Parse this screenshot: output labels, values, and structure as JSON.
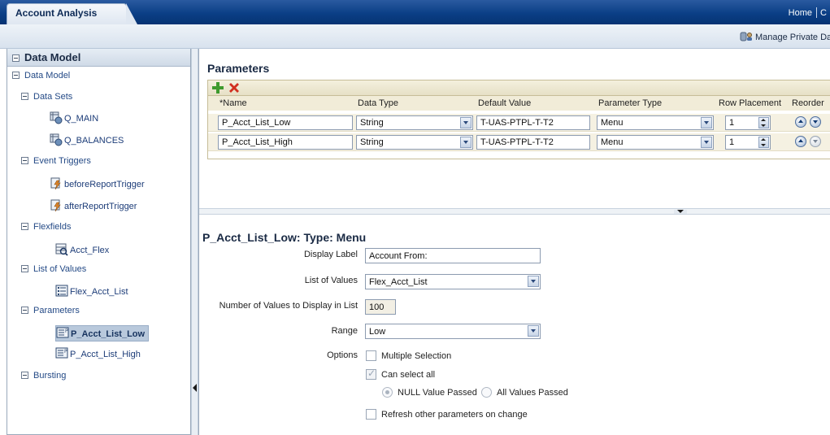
{
  "app": {
    "tab_title": "Account Analysis",
    "home_link": "Home",
    "overflow_link": "C"
  },
  "subbar": {
    "manage_private_data": "Manage Private Da"
  },
  "sidebar": {
    "header": "Data Model",
    "root": "Data Model",
    "groups": [
      {
        "label": "Data Sets",
        "items": [
          "Q_MAIN",
          "Q_BALANCES"
        ]
      },
      {
        "label": "Event Triggers",
        "items": [
          "beforeReportTrigger",
          "afterReportTrigger"
        ]
      },
      {
        "label": "Flexfields",
        "items": [
          "Acct_Flex"
        ]
      },
      {
        "label": "List of Values",
        "items": [
          "Flex_Acct_List"
        ]
      },
      {
        "label": "Parameters",
        "items": [
          "P_Acct_List_Low",
          "P_Acct_List_High"
        ]
      },
      {
        "label": "Bursting",
        "items": []
      }
    ],
    "selected": "P_Acct_List_Low"
  },
  "parameters": {
    "title": "Parameters",
    "columns": {
      "name": "*Name",
      "data_type": "Data Type",
      "default_value": "Default Value",
      "parameter_type": "Parameter Type",
      "row_placement": "Row Placement",
      "reorder": "Reorder"
    },
    "rows": [
      {
        "name": "P_Acct_List_Low",
        "data_type": "String",
        "default_value": "T-UAS-PTPL-T-T2",
        "parameter_type": "Menu",
        "row_placement": "1"
      },
      {
        "name": "P_Acct_List_High",
        "data_type": "String",
        "default_value": "T-UAS-PTPL-T-T2",
        "parameter_type": "Menu",
        "row_placement": "1"
      }
    ]
  },
  "detail": {
    "title": "P_Acct_List_Low: Type: Menu",
    "display_label_label": "Display Label",
    "display_label_value": "Account From:",
    "lov_label": "List of Values",
    "lov_value": "Flex_Acct_List",
    "num_values_label": "Number of Values to Display in List",
    "num_values_value": "100",
    "range_label": "Range",
    "range_value": "Low",
    "options_label": "Options",
    "multiple_selection": "Multiple Selection",
    "can_select_all": "Can select all",
    "null_value_passed": "NULL Value Passed",
    "all_values_passed": "All Values Passed",
    "refresh_other": "Refresh other parameters on change"
  },
  "colors": {
    "topbar": "#0b3f86",
    "grid_toolbar": "#e6e0c6",
    "link": "#1c3c78"
  }
}
